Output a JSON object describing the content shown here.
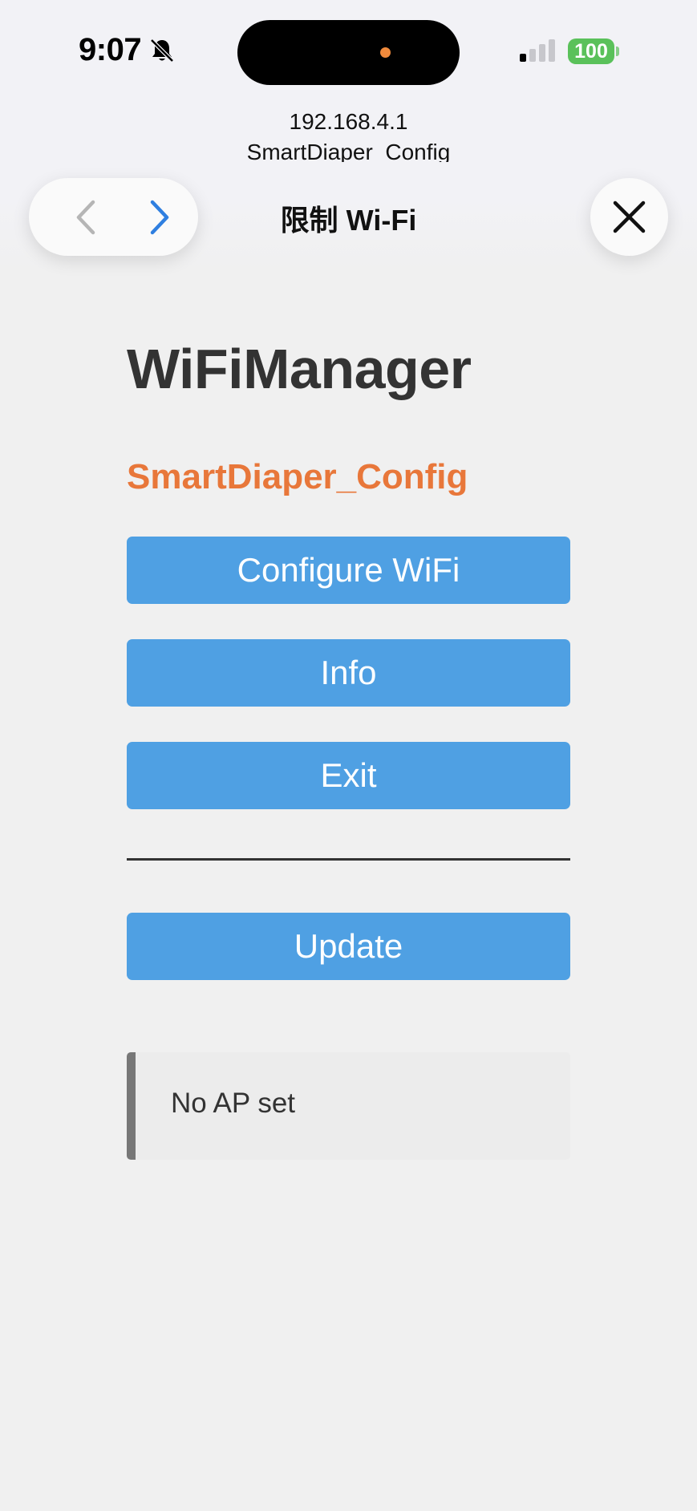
{
  "status_bar": {
    "time": "9:07",
    "battery": "100",
    "colors": {
      "battery_green": "#5ac15a",
      "island_dot": "#f08a3c"
    }
  },
  "captive_sheet": {
    "url": "192.168.4.1",
    "host_name": "SmartDiaper_Config",
    "title": "限制 Wi-Fi",
    "icons": [
      "back-chevron-icon",
      "forward-chevron-icon",
      "close-icon"
    ]
  },
  "page": {
    "heading": "WiFiManager",
    "device_name": "SmartDiaper_Config",
    "buttons": {
      "configure": "Configure WiFi",
      "info": "Info",
      "exit": "Exit",
      "update": "Update"
    },
    "status_message": "No AP set",
    "colors": {
      "button_blue": "#4fa0e3",
      "device_name_orange": "#e8773a",
      "heading_text": "#333333"
    }
  }
}
